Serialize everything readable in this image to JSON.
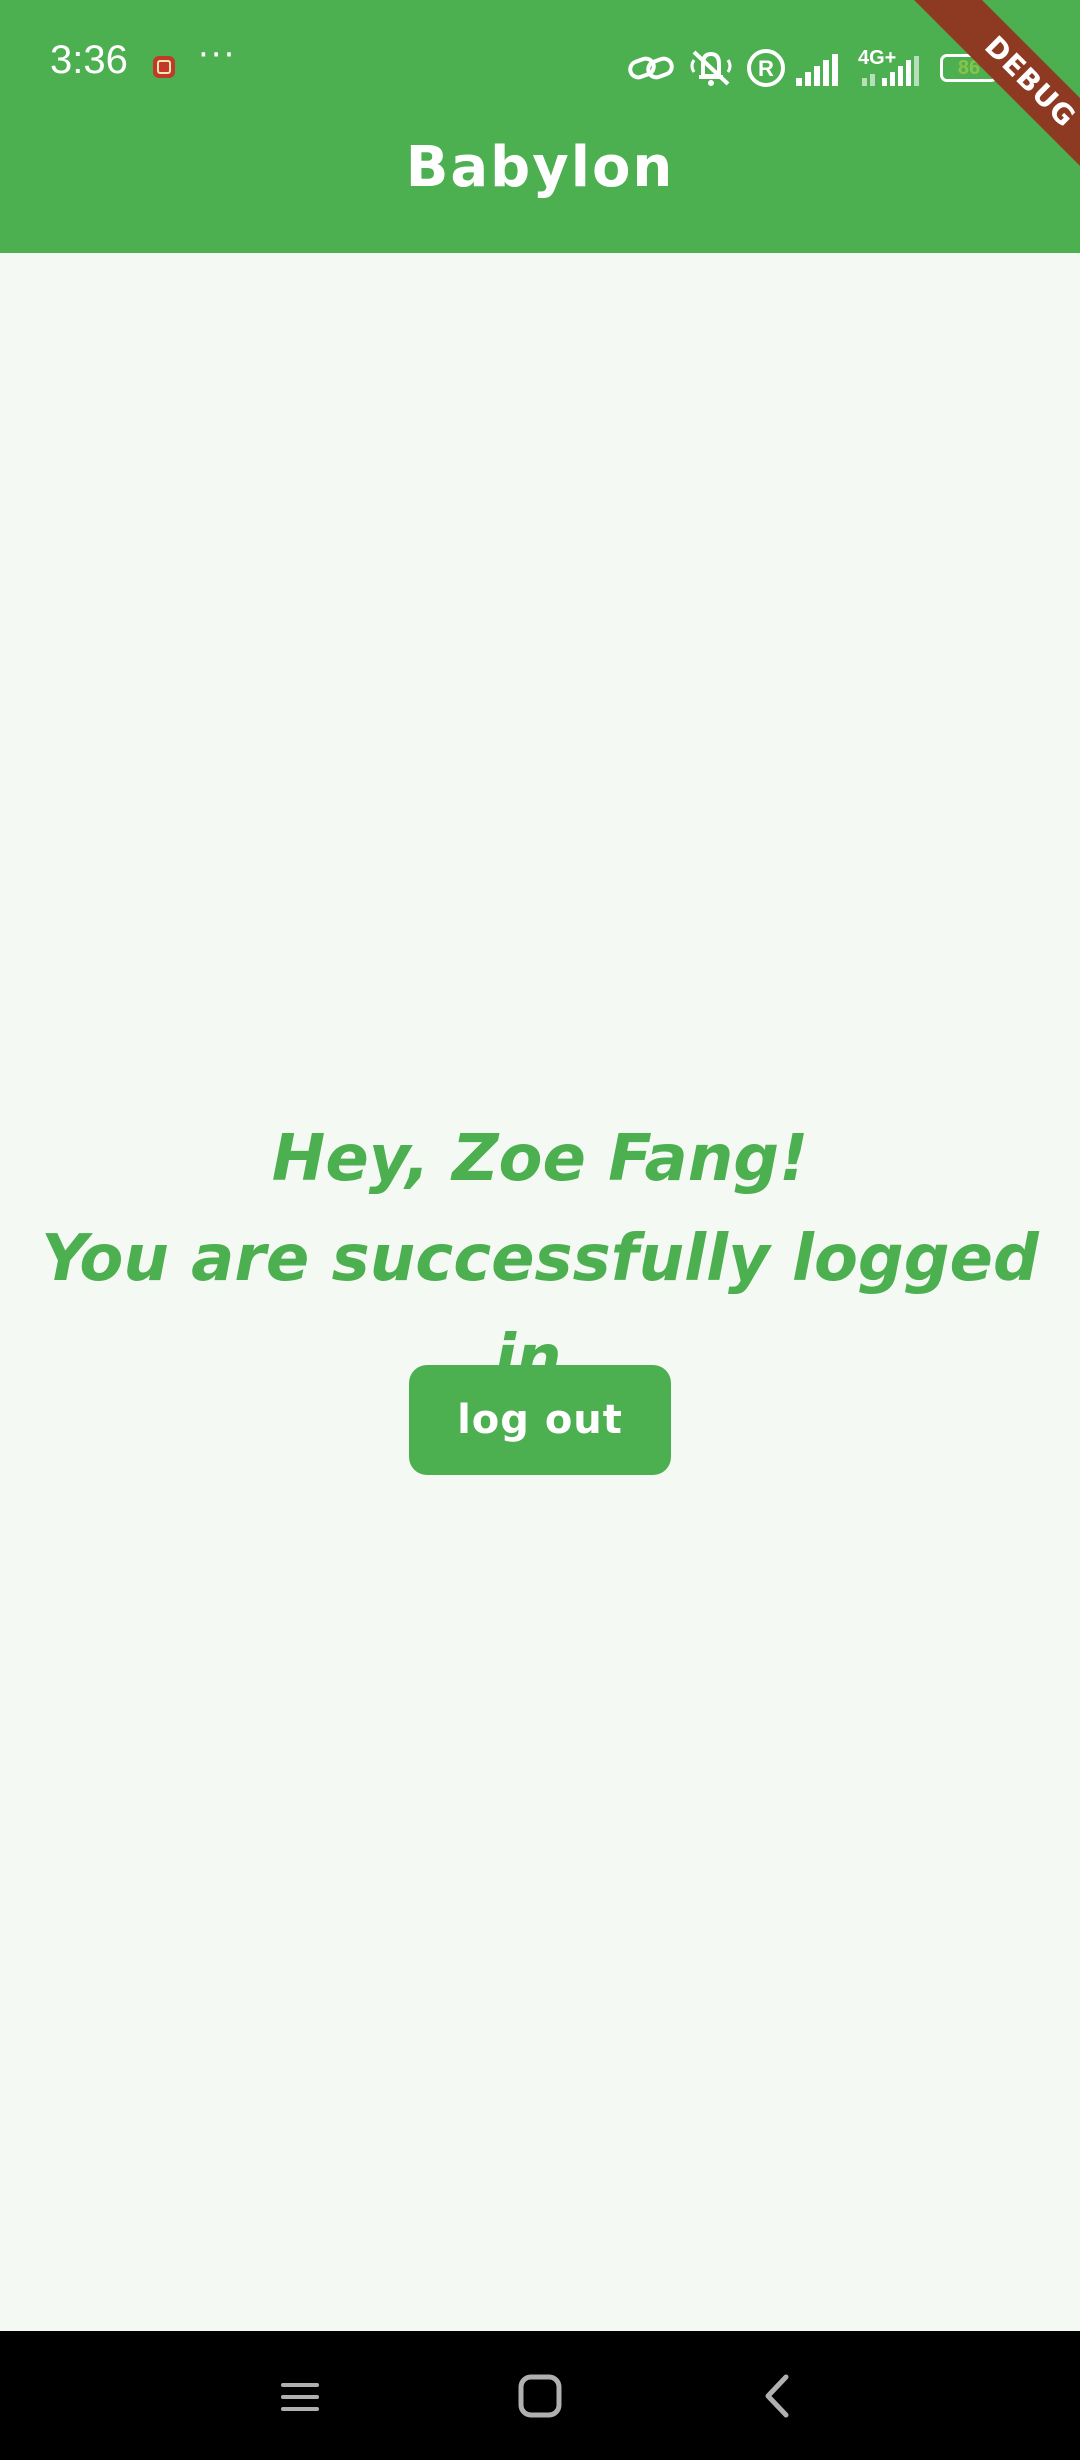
{
  "status_bar": {
    "time": "3:36",
    "notification_icons": [
      "app-notification-icon",
      "more-dots-icon"
    ],
    "system_icons": [
      "link-icon",
      "vibrate-mute-icon",
      "registered-icon",
      "signal-icon",
      "signal-4g-icon"
    ],
    "network_label": "4G+",
    "battery_level": "86",
    "more_indicator": "···"
  },
  "app_bar": {
    "title": "Babylon"
  },
  "debug_banner": {
    "label": "DEBUG"
  },
  "main": {
    "greeting_line1": "Hey, Zoe Fang!",
    "greeting_line2": "You are successfully logged in.",
    "logout_label": "log out"
  },
  "nav_bar": {
    "buttons": [
      "menu-icon",
      "home-icon",
      "back-icon"
    ]
  },
  "colors": {
    "primary": "#4caf50",
    "background": "#f5f9f3",
    "debug_banner": "#8e3a23",
    "battery_text": "#8bc34a",
    "nav_background": "#000000"
  }
}
